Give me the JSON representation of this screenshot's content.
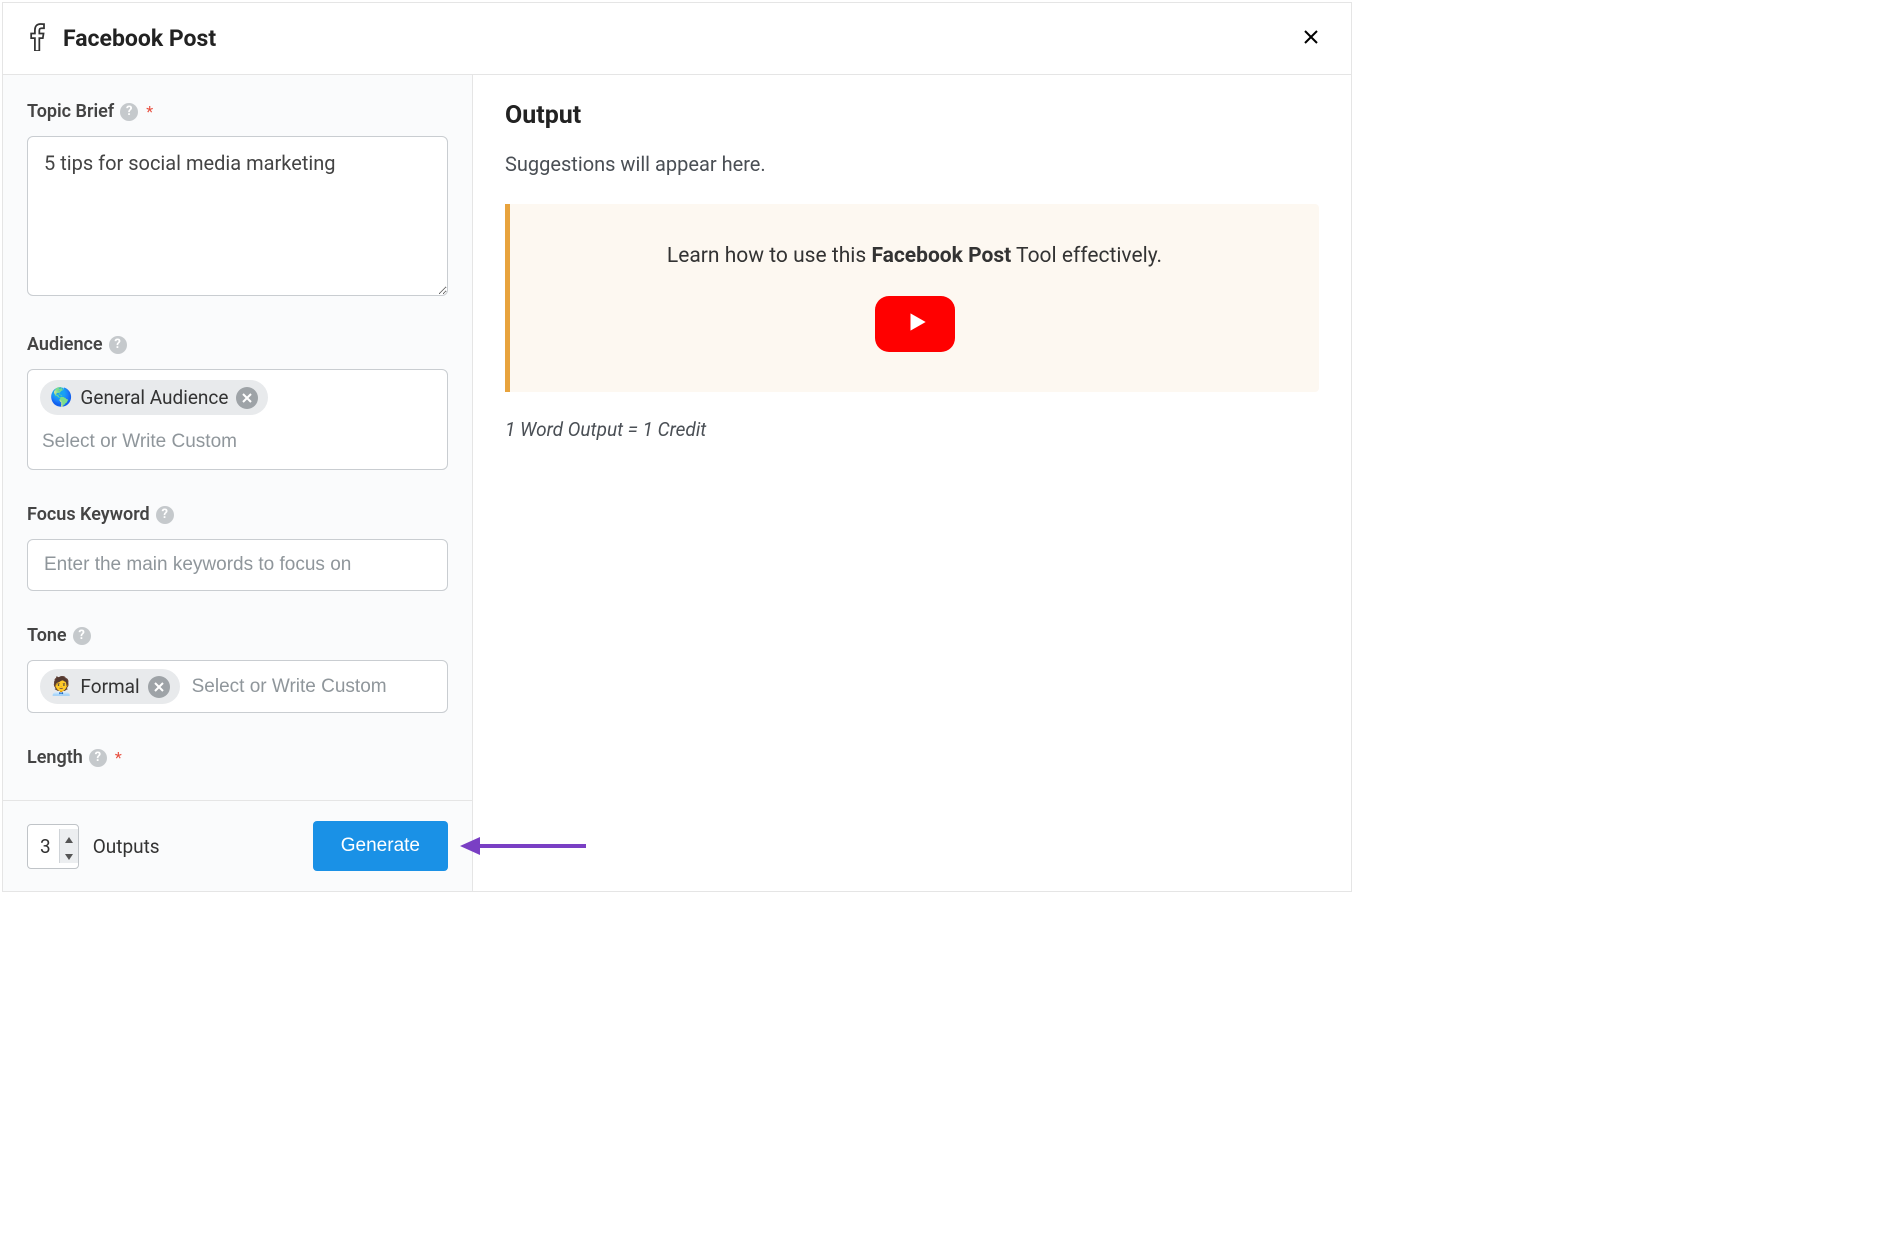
{
  "header": {
    "title": "Facebook Post"
  },
  "form": {
    "topic": {
      "label": "Topic Brief",
      "value": "5 tips for social media marketing"
    },
    "audience": {
      "label": "Audience",
      "chip_emoji": "🌎",
      "chip_label": "General Audience",
      "placeholder": "Select or Write Custom"
    },
    "keyword": {
      "label": "Focus Keyword",
      "placeholder": "Enter the main keywords to focus on"
    },
    "tone": {
      "label": "Tone",
      "chip_emoji": "🧑‍💼",
      "chip_label": "Formal",
      "placeholder": "Select or Write Custom"
    },
    "length": {
      "label": "Length"
    }
  },
  "footer": {
    "outputs_value": "3",
    "outputs_label": "Outputs",
    "generate_label": "Generate"
  },
  "output": {
    "title": "Output",
    "subtitle": "Suggestions will appear here.",
    "banner_pre": "Learn how to use this ",
    "banner_bold": "Facebook Post",
    "banner_post": " Tool effectively.",
    "credit": "1 Word Output = 1 Credit"
  }
}
